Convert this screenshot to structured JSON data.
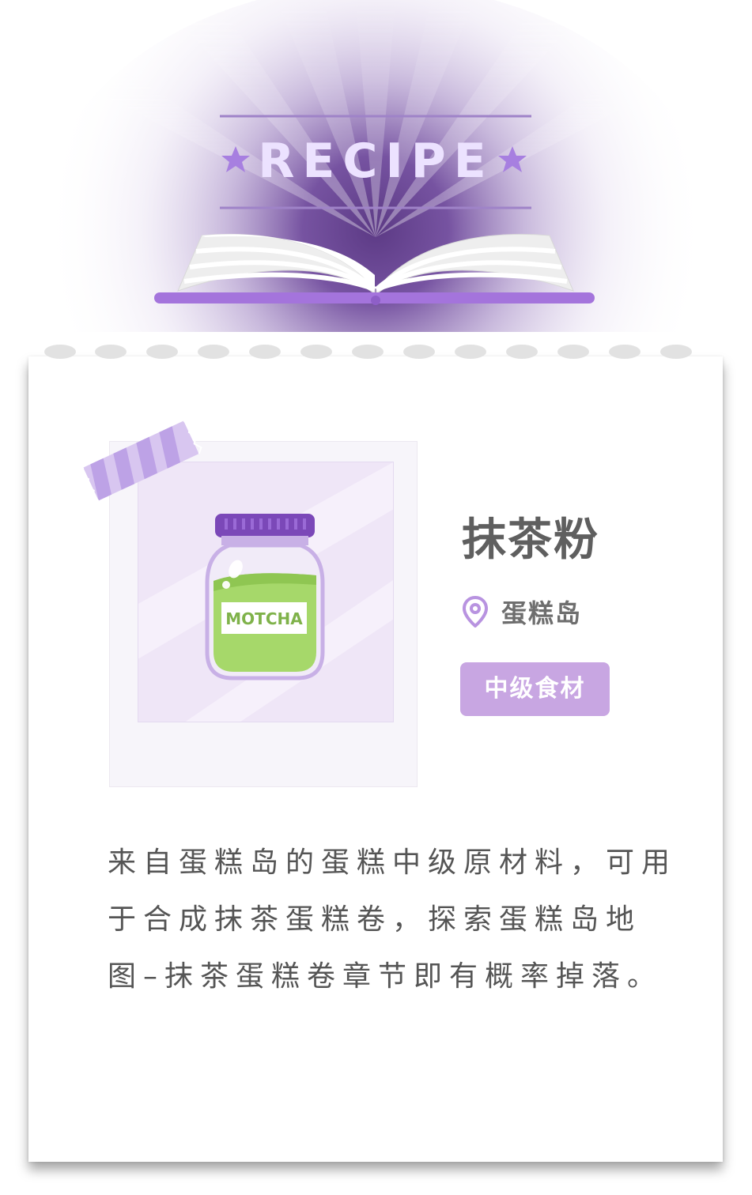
{
  "header": {
    "title": "RECIPE"
  },
  "item": {
    "name": "抹茶粉",
    "location": "蛋糕岛",
    "level": "中级食材",
    "jar_label": "MOTCHA"
  },
  "description": {
    "lines": [
      "来自蛋糕岛的蛋糕中级原材料，可用",
      "于合成抹茶蛋糕卷，探索蛋糕岛地",
      "图–抹茶蛋糕卷章节即有概率掉落。"
    ]
  },
  "icons": {
    "location": "location-pin-icon",
    "stars": "star-icon",
    "book": "open-book-icon"
  },
  "colors": {
    "accent_purple": "#9d6bd6",
    "badge_bg": "#c8a6e2",
    "jar_lid": "#7b48b8",
    "jar_liquid": "#a6d86a",
    "title_text": "#5f5f5f",
    "body_text": "#555555"
  }
}
